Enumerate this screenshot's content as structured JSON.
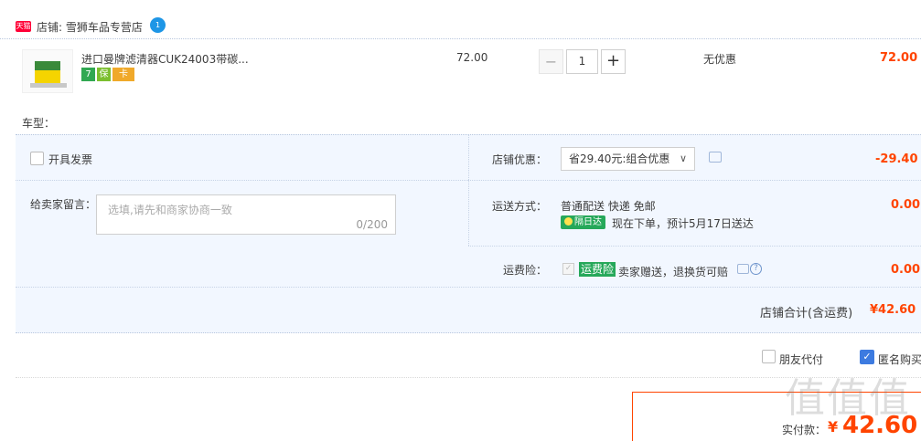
{
  "shop": {
    "badge": "天猫",
    "name": "店铺: 雪狮车品专营店",
    "chat_badge": "1"
  },
  "item": {
    "title": "进口曼牌滤清器CUK24003带碳...",
    "unit_price": "72.00",
    "quantity": "1",
    "minus": "−",
    "plus": "+",
    "discount_text": "无优惠",
    "line_total": "72.00",
    "service_icons": [
      "7",
      "保",
      "卡"
    ]
  },
  "car_model": {
    "label": "车型："
  },
  "invoice": {
    "label": "开具发票",
    "checked": false
  },
  "note": {
    "label": "给卖家留言：",
    "placeholder": "选填,请先和商家协商一致",
    "counter": "0/200"
  },
  "shop_promo": {
    "label": "店铺优惠：",
    "selected": "省29.40元:组合优惠",
    "amount": "-29.40"
  },
  "shipping": {
    "label": "运送方式：",
    "method": "普通配送 快递 免邮",
    "badge": "隔日达",
    "eta": "现在下单，预计5月17日送达",
    "amount": "0.00"
  },
  "insurance": {
    "label": "运费险：",
    "badge": "运费险",
    "desc": "卖家赠送，退换货可赔",
    "help": "?",
    "amount": "0.00"
  },
  "subtotal": {
    "label": "店铺合计(含运费)",
    "amount": "¥42.60"
  },
  "options": {
    "friend_pay": "朋友代付",
    "anonymous": "匿名购买",
    "anonymous_checked": true
  },
  "payment": {
    "label": "实付款：",
    "symbol": "¥",
    "amount": "42.60"
  },
  "watermark": "值值值"
}
